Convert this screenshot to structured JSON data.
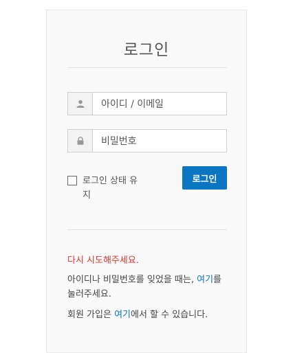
{
  "login": {
    "title": "로그인",
    "username": {
      "placeholder": "아이디 / 이메일",
      "icon": "user-icon"
    },
    "password": {
      "placeholder": "비밀번호",
      "icon": "lock-icon"
    },
    "remember_label": "로그인 상태 유지",
    "button_label": "로그인",
    "error": "다시 시도해주세요.",
    "forgot": {
      "before": "아이디나 비밀번호를 잊었을 때는, ",
      "link": "여기",
      "after": "를 눌러주세요."
    },
    "signup": {
      "before": "회원 가입은 ",
      "link": "여기",
      "after": "에서 할 수 있습니다."
    }
  },
  "colors": {
    "accent": "#0a75c2",
    "error": "#e0342b"
  }
}
